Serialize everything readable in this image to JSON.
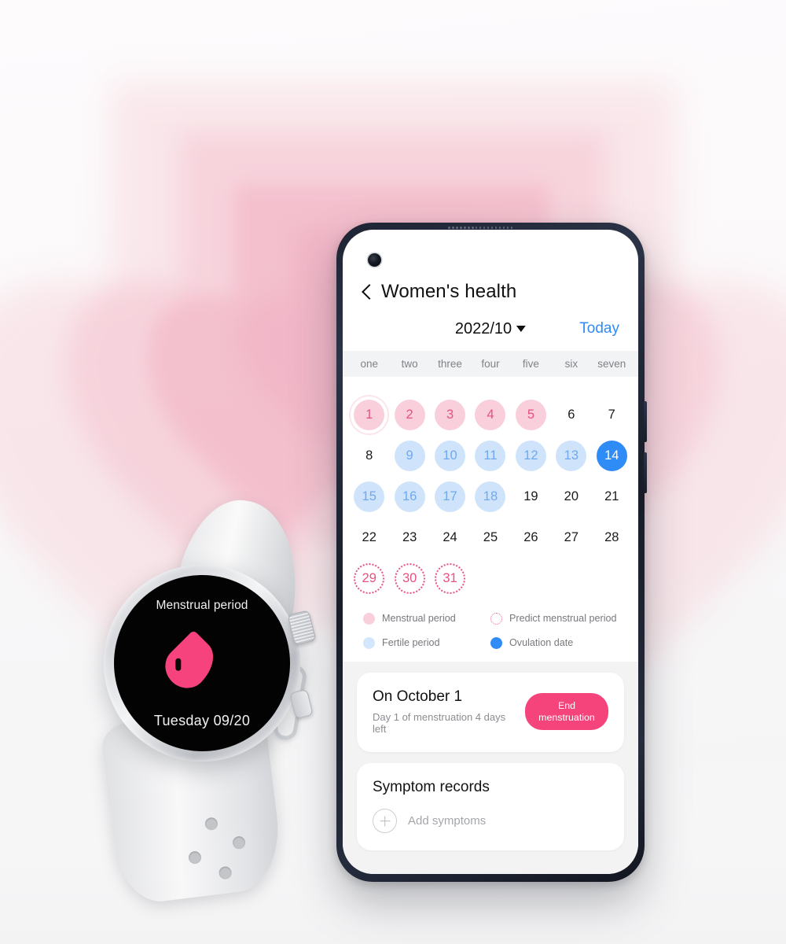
{
  "background": {
    "motif": "layered-hearts",
    "colors": [
      "#f7d7dd",
      "#f6c8d4",
      "#f3b9c9",
      "#f0aec1"
    ],
    "page_bg": "#f6f6f7"
  },
  "watch": {
    "face_title": "Menstrual period",
    "icon": "blood-drops-icon",
    "date": "Tuesday 09/20",
    "accent": "#f6437d"
  },
  "phone": {
    "app": {
      "back_icon": "back-chevron-icon",
      "title": "Women's health",
      "month": "2022/10",
      "month_caret": "chevron-down-icon",
      "today_label": "Today",
      "today_color": "#2f8bf5",
      "weekdays": [
        "one",
        "two",
        "three",
        "four",
        "five",
        "six",
        "seven"
      ],
      "calendar": {
        "leading_blanks": 0,
        "days": [
          {
            "n": "1",
            "state": "menstrual",
            "selected": true
          },
          {
            "n": "2",
            "state": "menstrual"
          },
          {
            "n": "3",
            "state": "menstrual"
          },
          {
            "n": "4",
            "state": "menstrual"
          },
          {
            "n": "5",
            "state": "menstrual"
          },
          {
            "n": "6",
            "state": "normal"
          },
          {
            "n": "7",
            "state": "normal"
          },
          {
            "n": "8",
            "state": "normal"
          },
          {
            "n": "9",
            "state": "fertile"
          },
          {
            "n": "10",
            "state": "fertile"
          },
          {
            "n": "11",
            "state": "fertile"
          },
          {
            "n": "12",
            "state": "fertile"
          },
          {
            "n": "13",
            "state": "fertile"
          },
          {
            "n": "14",
            "state": "ovulation"
          },
          {
            "n": "15",
            "state": "fertile"
          },
          {
            "n": "16",
            "state": "fertile"
          },
          {
            "n": "17",
            "state": "fertile"
          },
          {
            "n": "18",
            "state": "fertile"
          },
          {
            "n": "19",
            "state": "normal"
          },
          {
            "n": "20",
            "state": "normal"
          },
          {
            "n": "21",
            "state": "normal"
          },
          {
            "n": "22",
            "state": "normal"
          },
          {
            "n": "23",
            "state": "normal"
          },
          {
            "n": "24",
            "state": "normal"
          },
          {
            "n": "25",
            "state": "normal"
          },
          {
            "n": "26",
            "state": "normal"
          },
          {
            "n": "27",
            "state": "normal"
          },
          {
            "n": "28",
            "state": "normal"
          },
          {
            "n": "29",
            "state": "predict"
          },
          {
            "n": "30",
            "state": "predict"
          },
          {
            "n": "31",
            "state": "predict"
          }
        ]
      },
      "legend": [
        {
          "label": "Menstrual period",
          "swatch": "menstrual",
          "color": "#f9cfdb"
        },
        {
          "label": "Predict menstrual period",
          "swatch": "predict",
          "color": "#ec5f8c"
        },
        {
          "label": "Fertile period",
          "swatch": "fertile",
          "color": "#d3e6fb"
        },
        {
          "label": "Ovulation date",
          "swatch": "ovulation",
          "color": "#2f8bf5"
        }
      ],
      "status_card": {
        "title": "On October 1",
        "subtitle": "Day 1 of menstruation 4 days left",
        "button_label": "End menstruation",
        "button_color": "#f5437c"
      },
      "symptoms_card": {
        "title": "Symptom records",
        "add_icon": "plus-circle-icon",
        "add_label": "Add symptoms"
      }
    }
  }
}
